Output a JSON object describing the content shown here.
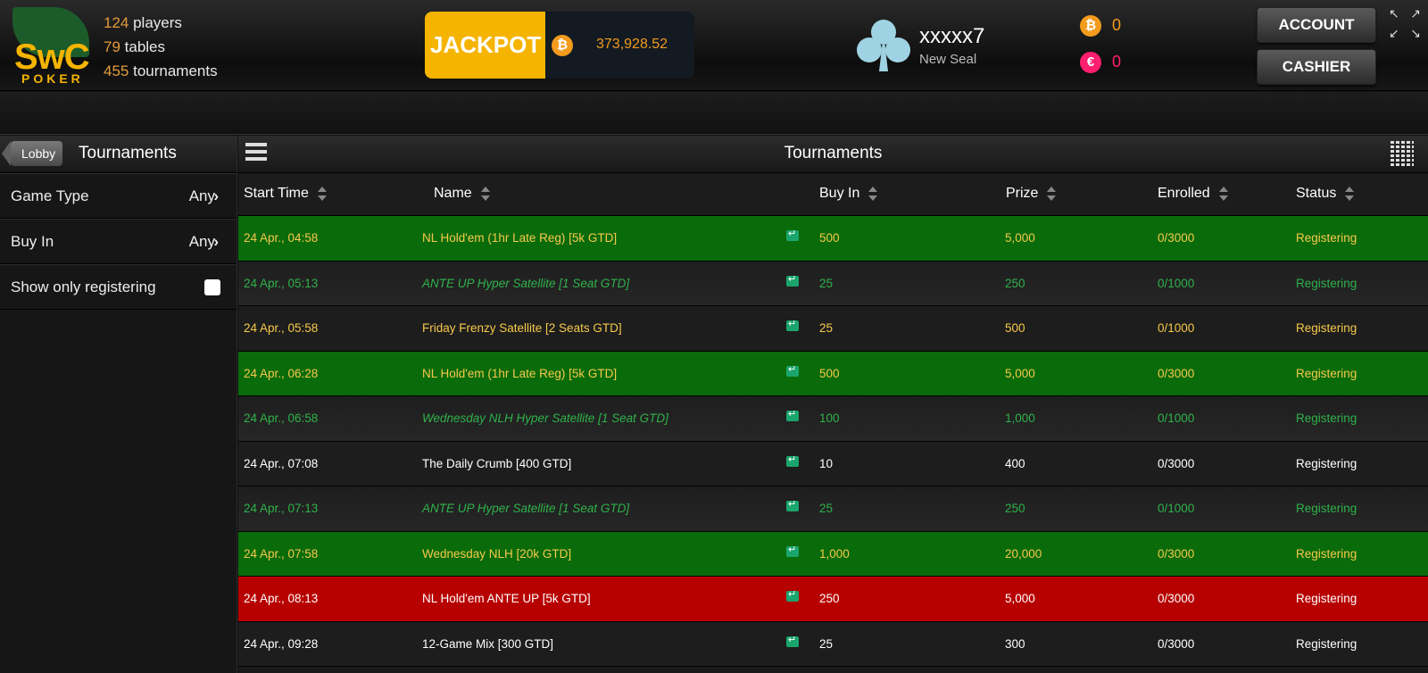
{
  "brand": {
    "logo_main": "SwC",
    "logo_sub": "POKER"
  },
  "stats": {
    "players_count": "124",
    "players_label": " players",
    "tables_count": "79",
    "tables_label": " tables",
    "tournaments_count": "455",
    "tournaments_label": " tournaments"
  },
  "jackpot": {
    "label": "JACKPOT",
    "coin": "₿",
    "amount": "373,928.52"
  },
  "user": {
    "name": "xxxxx7",
    "level": "New Seal"
  },
  "balances": [
    {
      "icon": "bitcoin-coin-icon",
      "glyph": "₿",
      "value": "0"
    },
    {
      "icon": "fun-coin-icon",
      "glyph": "€",
      "value": "0"
    }
  ],
  "buttons": {
    "account": "ACCOUNT",
    "cashier": "CASHIER"
  },
  "left": {
    "back_label": "Lobby",
    "title": "Tournaments",
    "filters": [
      {
        "label": "Game Type",
        "value": "Any"
      },
      {
        "label": "Buy In",
        "value": "Any"
      }
    ],
    "toggle_label": "Show only registering"
  },
  "main": {
    "title": "Tournaments",
    "columns": [
      "Start Time",
      "Name",
      "Buy In",
      "Prize",
      "Enrolled",
      "Status"
    ]
  },
  "rows": [
    {
      "time": "24 Apr., 04:58",
      "name": "NL Hold'em (1hr Late Reg) [5k GTD]",
      "buyin": "500",
      "prize": "5,000",
      "enrolled": "0/3000",
      "status": "Registering",
      "style": "st-green"
    },
    {
      "time": "24 Apr., 05:13",
      "name": "ANTE UP Hyper Satellite [1 Seat GTD]",
      "buyin": "25",
      "prize": "250",
      "enrolled": "0/1000",
      "status": "Registering",
      "style": "st-dark"
    },
    {
      "time": "24 Apr., 05:58",
      "name": "Friday Frenzy Satellite [2 Seats GTD]",
      "buyin": "25",
      "prize": "500",
      "enrolled": "0/1000",
      "status": "Registering",
      "style": "st-orange"
    },
    {
      "time": "24 Apr., 06:28",
      "name": "NL Hold'em (1hr Late Reg) [5k GTD]",
      "buyin": "500",
      "prize": "5,000",
      "enrolled": "0/3000",
      "status": "Registering",
      "style": "st-green"
    },
    {
      "time": "24 Apr., 06:58",
      "name": "Wednesday NLH Hyper Satellite [1 Seat GTD]",
      "buyin": "100",
      "prize": "1,000",
      "enrolled": "0/1000",
      "status": "Registering",
      "style": "st-dark"
    },
    {
      "time": "24 Apr., 07:08",
      "name": "The Daily Crumb [400 GTD]",
      "buyin": "10",
      "prize": "400",
      "enrolled": "0/3000",
      "status": "Registering",
      "style": "st-white"
    },
    {
      "time": "24 Apr., 07:13",
      "name": "ANTE UP Hyper Satellite [1 Seat GTD]",
      "buyin": "25",
      "prize": "250",
      "enrolled": "0/1000",
      "status": "Registering",
      "style": "st-dark"
    },
    {
      "time": "24 Apr., 07:58",
      "name": "Wednesday NLH [20k GTD]",
      "buyin": "1,000",
      "prize": "20,000",
      "enrolled": "0/3000",
      "status": "Registering",
      "style": "st-green"
    },
    {
      "time": "24 Apr., 08:13",
      "name": "NL Hold'em ANTE UP [5k GTD]",
      "buyin": "250",
      "prize": "5,000",
      "enrolled": "0/3000",
      "status": "Registering",
      "style": "st-red"
    },
    {
      "time": "24 Apr., 09:28",
      "name": "12-Game Mix [300 GTD]",
      "buyin": "25",
      "prize": "300",
      "enrolled": "0/3000",
      "status": "Registering",
      "style": "st-white"
    }
  ]
}
